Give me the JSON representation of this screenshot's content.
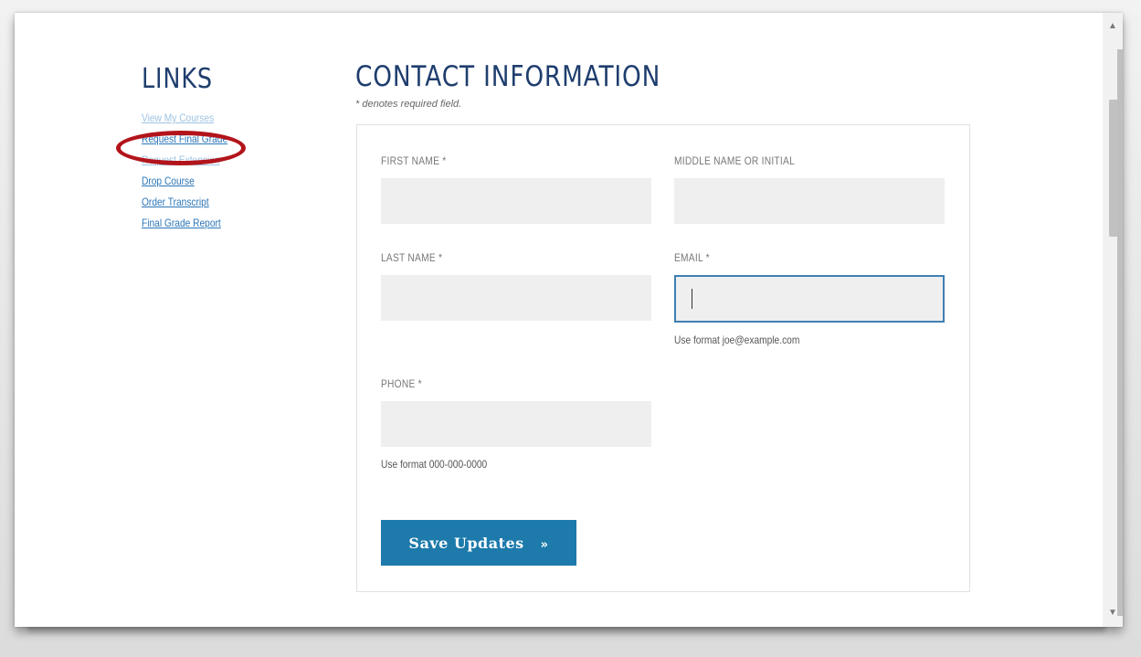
{
  "sidebar": {
    "title": "LINKS",
    "links": [
      {
        "label": "View My Courses"
      },
      {
        "label": "Request Final Grade"
      },
      {
        "label": "Request Extension"
      },
      {
        "label": "Drop Course"
      },
      {
        "label": "Order Transcript"
      },
      {
        "label": "Final Grade Report"
      }
    ]
  },
  "main": {
    "title": "CONTACT INFORMATION",
    "required_note": "* denotes required field.",
    "form": {
      "first_name": {
        "label": "FIRST NAME *",
        "value": ""
      },
      "middle_name": {
        "label": "MIDDLE NAME OR INITIAL",
        "value": ""
      },
      "last_name": {
        "label": "LAST NAME *",
        "value": ""
      },
      "email": {
        "label": "EMAIL *",
        "value": "",
        "hint": "Use format joe@example.com"
      },
      "phone": {
        "label": "PHONE *",
        "value": "",
        "hint": "Use format 000-000-0000"
      }
    },
    "save_button": {
      "label": "Save Updates",
      "chevron": "»"
    }
  },
  "scrollbar": {
    "up": "▲",
    "down": "▼"
  },
  "colors": {
    "heading": "#1f3e6e",
    "link": "#2b76b8",
    "button": "#1d7aab",
    "highlight": "#b3141b",
    "focus_border": "#3e7fb3"
  }
}
